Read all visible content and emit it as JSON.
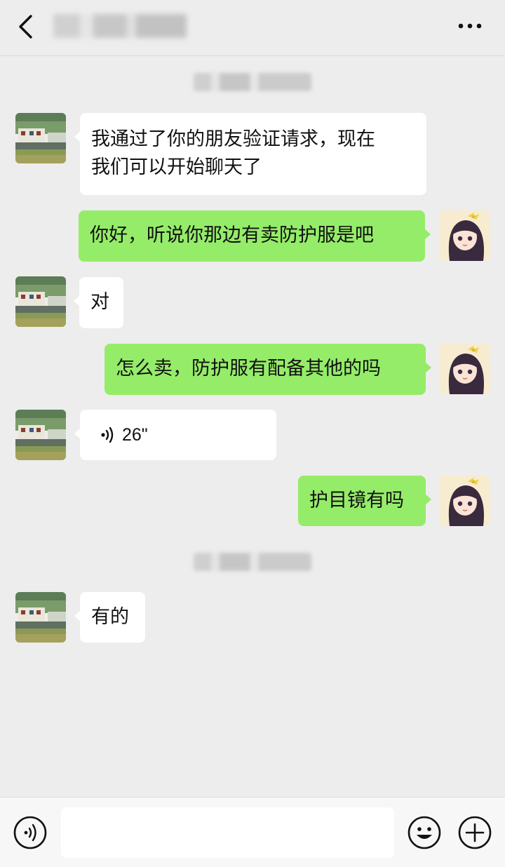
{
  "header": {
    "title": "",
    "back_icon": "chevron-left-icon",
    "more_icon": "more-dots-icon"
  },
  "colors": {
    "background": "#ededed",
    "incoming_bubble": "#ffffff",
    "outgoing_bubble": "#95ec69",
    "text": "#111111"
  },
  "messages": [
    {
      "direction": "in",
      "type": "text",
      "lines": [
        "我通过了你的朋友验证请求，现在",
        "我们可以开始聊天了"
      ]
    },
    {
      "direction": "out",
      "type": "text",
      "text": "你好，听说你那边有卖防护服是吧"
    },
    {
      "direction": "in",
      "type": "text",
      "text": "对"
    },
    {
      "direction": "out",
      "type": "text",
      "text": "怎么卖，防护服有配备其他的吗"
    },
    {
      "direction": "in",
      "type": "voice",
      "duration": "26\""
    },
    {
      "direction": "out",
      "type": "text",
      "text": "护目镜有吗"
    },
    {
      "direction": "in",
      "type": "text",
      "text": "有的"
    }
  ],
  "input_bar": {
    "placeholder": "",
    "voice_icon": "voice-icon",
    "emoji_icon": "emoji-icon",
    "plus_icon": "plus-icon"
  }
}
